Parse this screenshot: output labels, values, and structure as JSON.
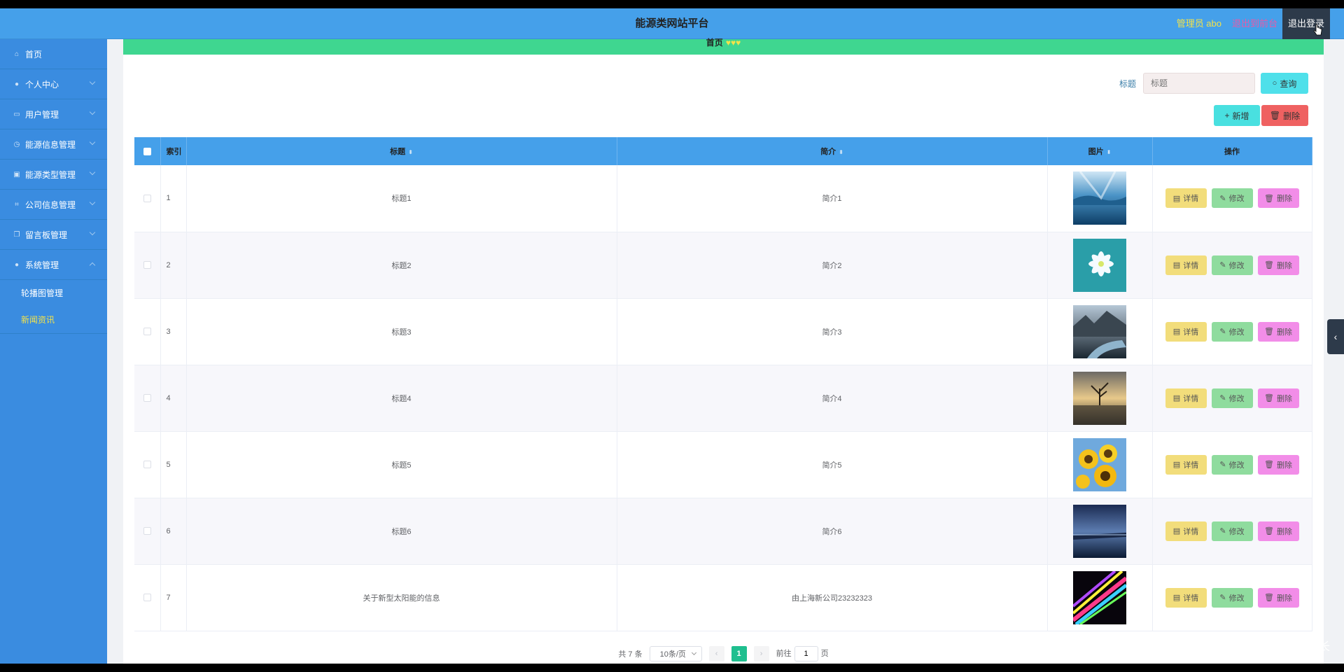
{
  "header": {
    "title": "能源类网站平台",
    "admin_label": "管理员 abo",
    "front_label": "退出到前台",
    "logout_label": "退出登录"
  },
  "sidebar": {
    "items": [
      {
        "label": "首页",
        "icon": "home-icon"
      },
      {
        "label": "个人中心",
        "icon": "user-icon"
      },
      {
        "label": "用户管理",
        "icon": "card-icon"
      },
      {
        "label": "能源信息管理",
        "icon": "clock-icon"
      },
      {
        "label": "能源类型管理",
        "icon": "square-icon"
      },
      {
        "label": "公司信息管理",
        "icon": "crop-icon"
      },
      {
        "label": "留言板管理",
        "icon": "copy-icon"
      },
      {
        "label": "系统管理",
        "icon": "user-icon"
      }
    ],
    "sub_items": [
      {
        "label": "轮播图管理",
        "active": false
      },
      {
        "label": "新闻资讯",
        "active": true
      }
    ]
  },
  "breadcrumb": {
    "home": "首页"
  },
  "search": {
    "label": "标题",
    "placeholder": "标题",
    "query_label": "查询"
  },
  "actions": {
    "add_label": "新增",
    "delete_label": "删除"
  },
  "table": {
    "headers": {
      "index": "索引",
      "title": "标题",
      "intro": "简介",
      "image": "图片",
      "ops": "操作"
    },
    "row_actions": {
      "detail": "详情",
      "edit": "修改",
      "remove": "删除"
    },
    "rows": [
      {
        "index": "1",
        "title": "标题1",
        "intro": "简介1"
      },
      {
        "index": "2",
        "title": "标题2",
        "intro": "简介2"
      },
      {
        "index": "3",
        "title": "标题3",
        "intro": "简介3"
      },
      {
        "index": "4",
        "title": "标题4",
        "intro": "简介4"
      },
      {
        "index": "5",
        "title": "标题5",
        "intro": "简介5"
      },
      {
        "index": "6",
        "title": "标题6",
        "intro": "简介6"
      },
      {
        "index": "7",
        "title": "关于新型太阳能的信息",
        "intro": "由上海新公司23232323"
      }
    ]
  },
  "pagination": {
    "total": "共 7 条",
    "page_size": "10条/页",
    "current_page": "1",
    "goto_label": "前往",
    "goto_value": "1",
    "page_suffix": "页"
  },
  "watermark": "CSDN @卓杰学长",
  "colors": {
    "topbar": "#45a0ea",
    "sidebar": "#3a8ce0",
    "breadcrumb": "#3fd690",
    "accent_yellow": "#f3e24a"
  }
}
